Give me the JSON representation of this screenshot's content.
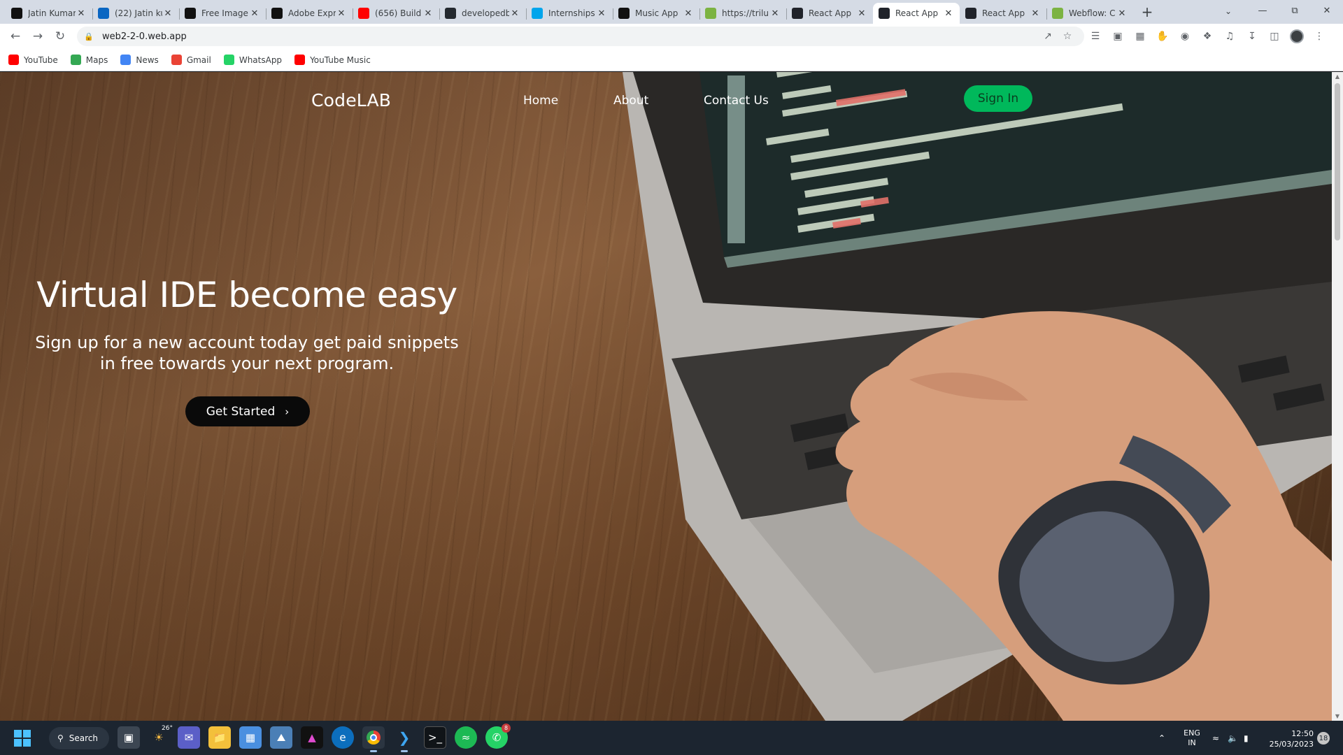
{
  "browser": {
    "tabs": [
      {
        "title": "Jatin Kumar",
        "icon": "threads-icon",
        "color": "#111111"
      },
      {
        "title": "(22) Jatin ku",
        "icon": "linkedin-icon",
        "color": "#0a66c2"
      },
      {
        "title": "Free Image",
        "icon": "adobe-express-icon",
        "color": "#111111"
      },
      {
        "title": "Adobe Expr",
        "icon": "adobe-express-icon",
        "color": "#111111"
      },
      {
        "title": "(656) Build",
        "icon": "youtube-icon",
        "color": "#ff0000"
      },
      {
        "title": "developedb",
        "icon": "github-icon",
        "color": "#24292f"
      },
      {
        "title": "Internships",
        "icon": "internshala-icon",
        "color": "#00a5ec"
      },
      {
        "title": "Music App",
        "icon": "headphones-icon",
        "color": "#111111"
      },
      {
        "title": "https://trilu",
        "icon": "globe-icon",
        "color": "#7cb342"
      },
      {
        "title": "React App",
        "icon": "react-icon",
        "color": "#20232a"
      },
      {
        "title": "React App",
        "icon": "react-icon",
        "color": "#20232a"
      },
      {
        "title": "React App",
        "icon": "react-icon",
        "color": "#20232a"
      },
      {
        "title": "Webflow: C",
        "icon": "globe-icon",
        "color": "#7cb342"
      }
    ],
    "active_tab_index": 10,
    "url": "web2-2-0.web.app",
    "bookmarks": [
      {
        "label": "YouTube",
        "icon": "youtube-icon",
        "color": "#ff0000"
      },
      {
        "label": "Maps",
        "icon": "maps-icon",
        "color": "#34a853"
      },
      {
        "label": "News",
        "icon": "news-icon",
        "color": "#4285f4"
      },
      {
        "label": "Gmail",
        "icon": "gmail-icon",
        "color": "#ea4335"
      },
      {
        "label": "WhatsApp",
        "icon": "whatsapp-icon",
        "color": "#25d366"
      },
      {
        "label": "YouTube Music",
        "icon": "youtube-music-icon",
        "color": "#ff0000"
      }
    ]
  },
  "site": {
    "logo": "CodeLAB",
    "nav": {
      "home": "Home",
      "about": "About",
      "contact": "Contact Us"
    },
    "signin": "Sign In",
    "accent_color": "#00b85b",
    "hero": {
      "title": "Virtual IDE become easy",
      "subtitle": "Sign up for a new account today get paid snippets in free towards your next program.",
      "cta": "Get Started"
    }
  },
  "taskbar": {
    "search": "Search",
    "weather_temp": "26°",
    "whatsapp_badge": "8",
    "lang_line1": "ENG",
    "lang_line2": "IN",
    "time": "12:50",
    "date": "25/03/2023",
    "notifications": "18"
  }
}
